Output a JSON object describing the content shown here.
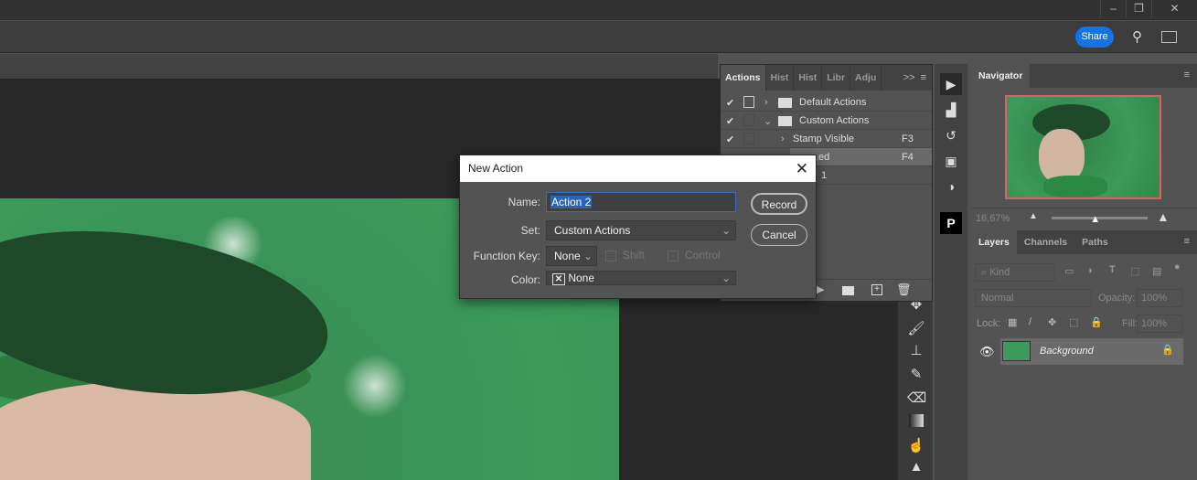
{
  "window": {
    "minimize": "–",
    "restore": "❐",
    "close": "✕"
  },
  "optionsbar": {
    "share_label": "Share"
  },
  "actions_panel": {
    "tabs": [
      "Actions",
      "Hist",
      "Hist",
      "Libr",
      "Adju"
    ],
    "overflow": ">>",
    "rows": [
      {
        "name": "Default Actions",
        "key": ""
      },
      {
        "name": "Custom Actions",
        "key": ""
      },
      {
        "name": "Stamp Visible",
        "key": "F3"
      },
      {
        "name": "…ed",
        "key": "F4"
      },
      {
        "name": "1",
        "key": ""
      }
    ]
  },
  "navigator": {
    "title": "Navigator",
    "zoom": "16,67%",
    "zoom_fraction": 0.45
  },
  "layers_panel": {
    "tabs": [
      "Layers",
      "Channels",
      "Paths"
    ],
    "filter_placeholder": "Kind",
    "blend_mode": "Normal",
    "opacity_label": "Opacity:",
    "opacity": "100%",
    "lock_label": "Lock:",
    "fill_label": "Fill:",
    "fill": "100%",
    "layers": [
      {
        "name": "Background"
      }
    ]
  },
  "dialog": {
    "title": "New Action",
    "name_label": "Name:",
    "name_value": "Action 2",
    "set_label": "Set:",
    "set_value": "Custom Actions",
    "fkey_label": "Function Key:",
    "fkey_value": "None",
    "shift_label": "Shift",
    "control_label": "Control",
    "color_label": "Color:",
    "color_value": "None",
    "record_label": "Record",
    "cancel_label": "Cancel"
  }
}
